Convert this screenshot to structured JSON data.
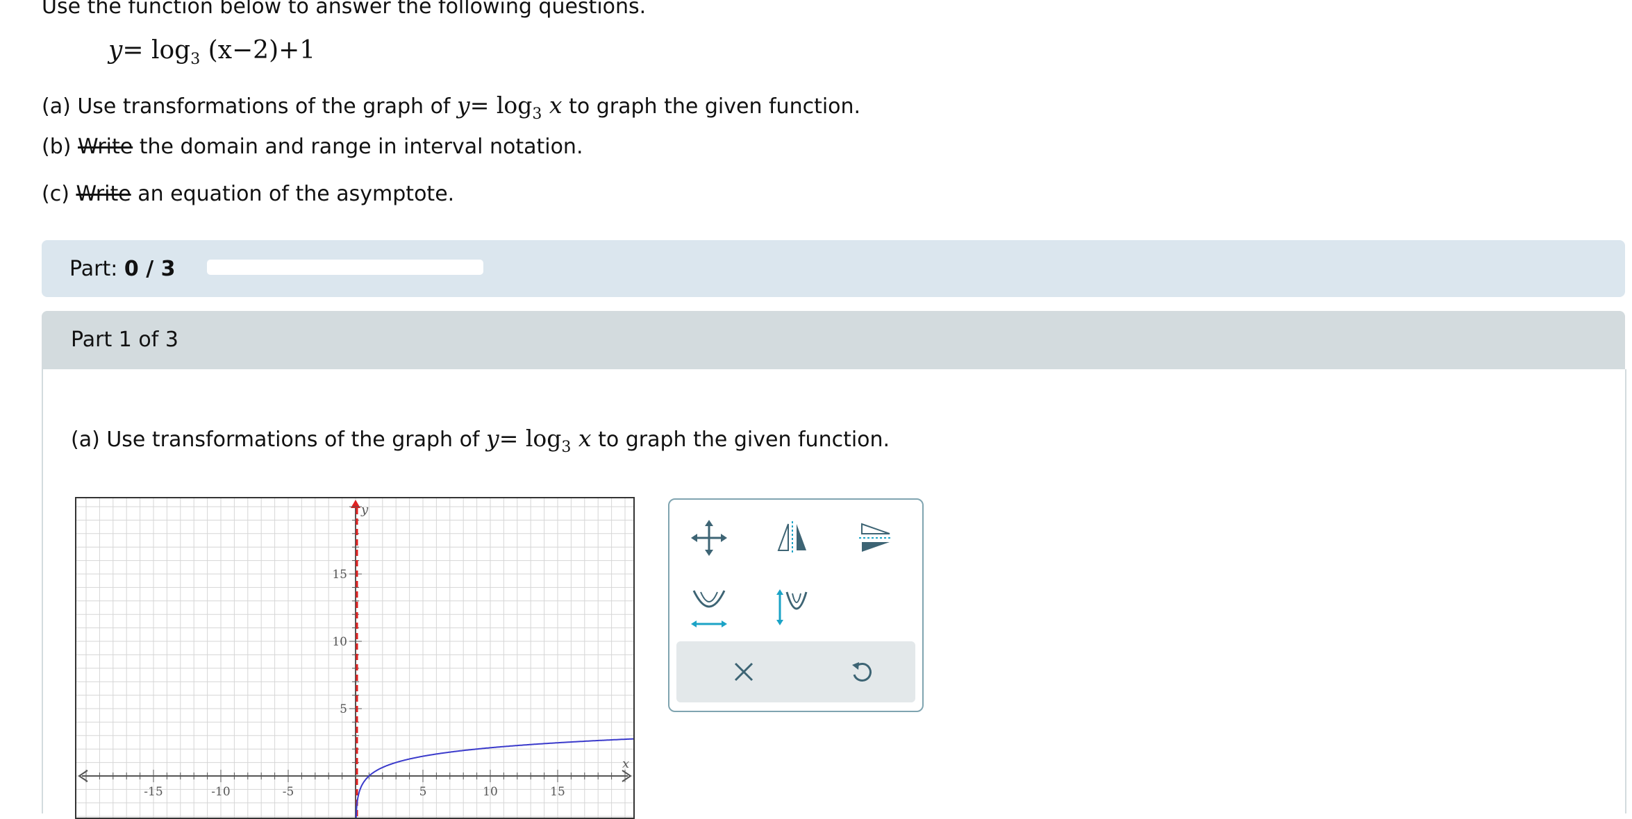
{
  "intro": "Use the function below to answer the following questions.",
  "function": {
    "y": "y",
    "eq": "=",
    "log": "log",
    "base": "3",
    "arg": "(x−2)",
    "rest": "+1"
  },
  "questions": {
    "a_prefix": "(a) Use transformations of the graph of",
    "a_suffix": "to graph the given function.",
    "b_prefix": "(b)",
    "b_strike": "Write",
    "b_rest": "the domain and range in interval notation.",
    "c_prefix": "(c)",
    "c_strike": "Write",
    "c_rest": "an equation of the asymptote."
  },
  "parent_function": {
    "y": "y",
    "eq": "=",
    "log": "log",
    "base": "3",
    "x": "x"
  },
  "progress": {
    "label": "Part:",
    "value": "0 / 3",
    "fraction": 0
  },
  "part_header": "Part 1 of 3",
  "part_question": {
    "prefix": "(a) Use transformations of the graph of",
    "suffix": "to graph the given function."
  },
  "graph": {
    "x_axis_label": "x",
    "y_axis_label": "y",
    "x_ticks": [
      "-15",
      "-10",
      "-5",
      "5",
      "10",
      "15"
    ],
    "y_ticks": [
      "15",
      "10",
      "5"
    ],
    "asymptote_x": 2,
    "curve": "y = log3(x - 2) + 1",
    "colors": {
      "curve": "#3a3acb",
      "asymptote": "#e02020",
      "grid": "#d6d6d6",
      "axis": "#555555"
    }
  },
  "toolbox": {
    "tools": [
      "move-icon",
      "reflect-y-icon",
      "reflect-x-icon",
      "stretch-horizontal-icon",
      "stretch-vertical-icon"
    ],
    "actions": [
      "close-icon",
      "undo-icon"
    ],
    "colors": {
      "icon": "#3d6474",
      "accent": "#1ba3c6"
    }
  }
}
